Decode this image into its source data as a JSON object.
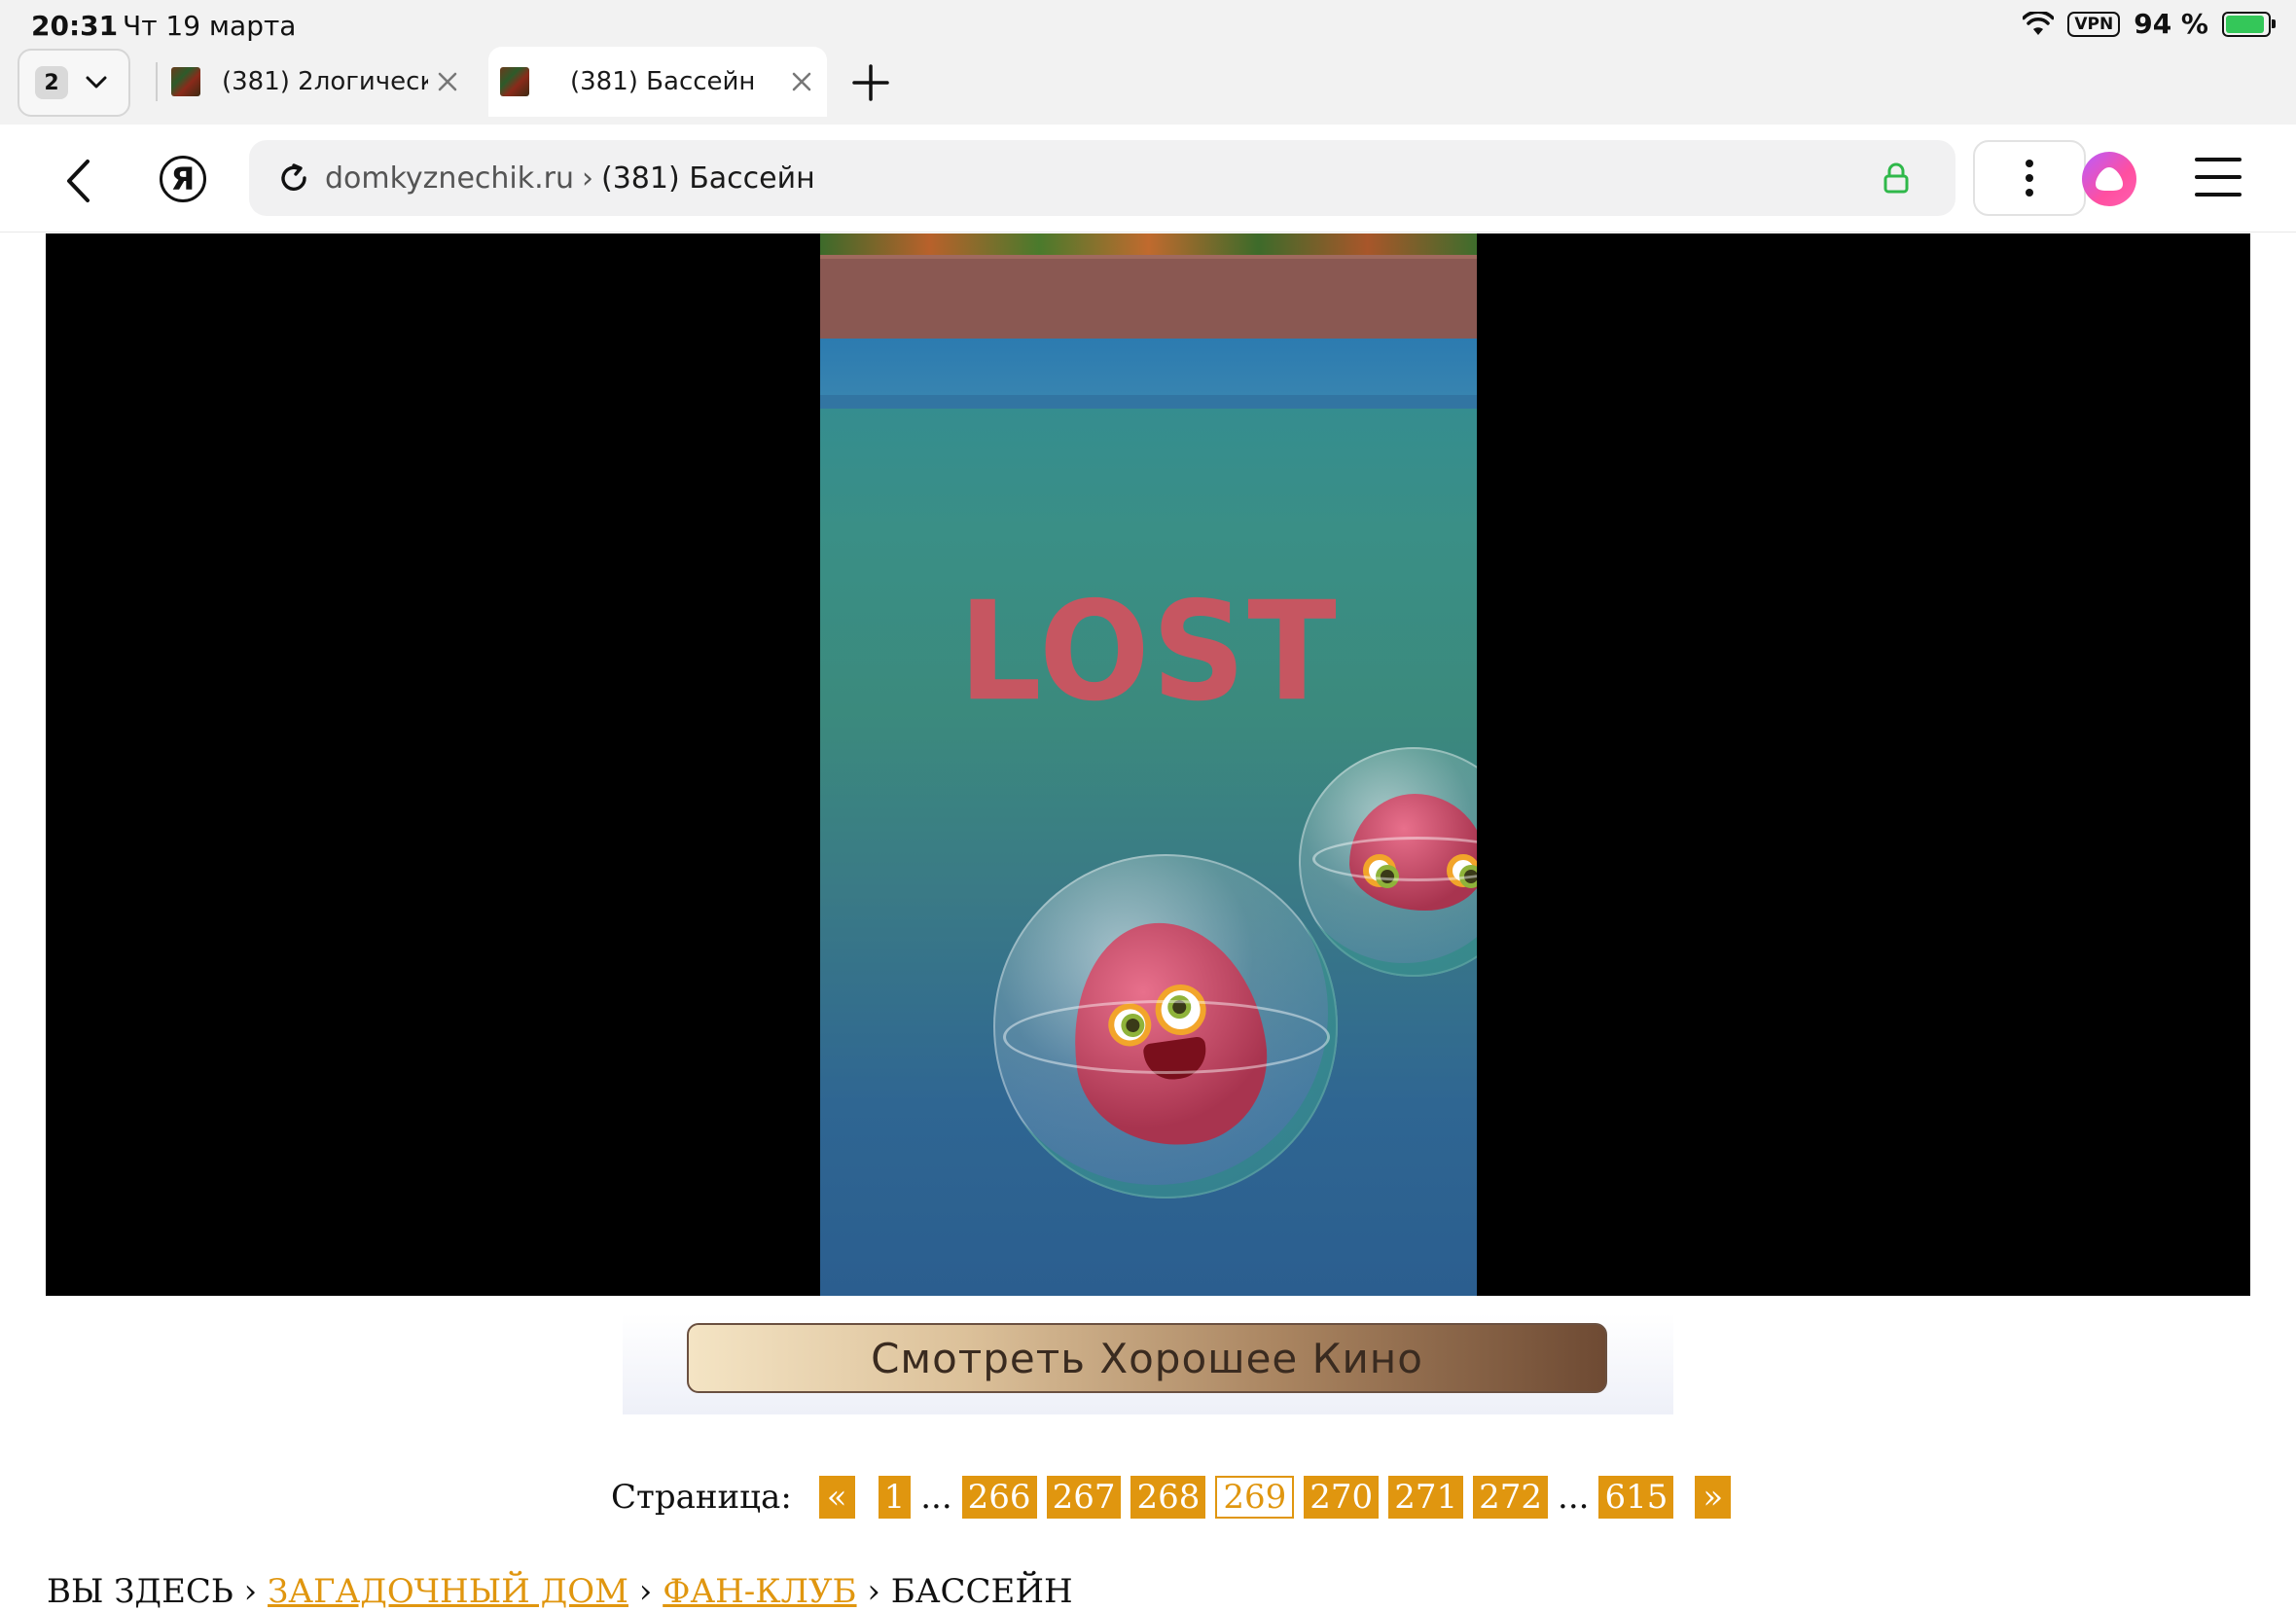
{
  "status_bar": {
    "time": "20:31",
    "date": "Чт 19 марта",
    "vpn_label": "VPN",
    "battery_percent": "94 %",
    "battery_level": 0.94,
    "charging": true
  },
  "tabs": {
    "count": "2",
    "items": [
      {
        "title": "(381) 2логическ...",
        "active": false
      },
      {
        "title": "(381) Бассейн",
        "active": true
      }
    ]
  },
  "toolbar": {
    "yandex_logo": "Я",
    "url_domain": "domkyznechik.ru",
    "url_separator": "›",
    "url_title": "(381) Бассейн"
  },
  "game": {
    "overlay_text": "LOST"
  },
  "banner": {
    "label": "Смотреть Хорошее Кино"
  },
  "pagination": {
    "label": "Страница:",
    "prev": "«",
    "first": "1",
    "ellipsis": "...",
    "pages": [
      "266",
      "267",
      "268",
      "269",
      "270",
      "271",
      "272"
    ],
    "current": "269",
    "last": "615",
    "next": "»"
  },
  "breadcrumb": {
    "prefix": "ВЫ ЗДЕСЬ",
    "sep": "›",
    "items": [
      "ЗАГАДОЧНЫЙ ДОМ",
      "ФАН-КЛУБ",
      "БАССЕЙН"
    ]
  },
  "colors": {
    "accent": "#e0960f",
    "lost_text": "#c65661",
    "battery": "#34c759"
  }
}
